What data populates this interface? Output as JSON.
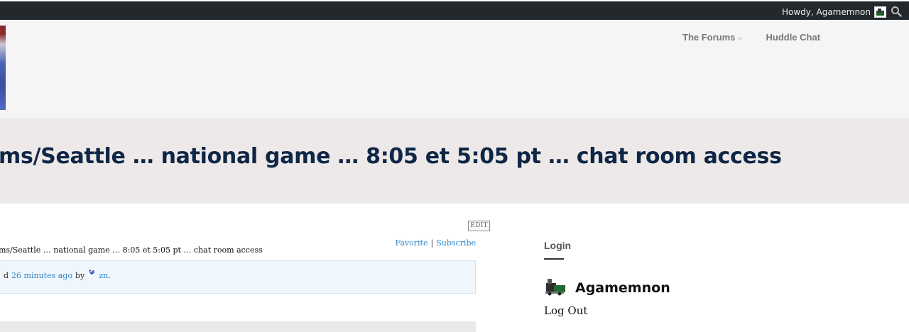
{
  "adminbar": {
    "greeting": "Howdy, Agamemnon",
    "search_icon": "search-icon",
    "avatar_icon": "user-avatar-icon"
  },
  "nav": {
    "items": [
      {
        "label": "The Forums",
        "has_dropdown": true
      },
      {
        "label": "Huddle Chat",
        "has_dropdown": false
      }
    ]
  },
  "page": {
    "title": "ms/Seattle … national game … 8:05 et 5:05 pt … chat room access"
  },
  "topic": {
    "edit_label": "EDIT",
    "favorite_label": "Favorite",
    "separator": "|",
    "subscribe_label": "Subscribe",
    "breadcrumb_title": "ms/Seattle … national game … 8:05 et 5:05 pt … chat room access",
    "notice_prefix": "d",
    "notice_time": "26 minutes ago",
    "notice_by": "by",
    "notice_author": "zn",
    "notice_suffix": "."
  },
  "sidebar": {
    "login_heading": "Login",
    "username": "Agamemnon",
    "logout_label": "Log Out"
  },
  "colors": {
    "adminbar_bg": "#23282d",
    "header_bg": "#f5f5f5",
    "title_band_bg": "#ede9e8",
    "title_color": "#0f2746",
    "link_color": "#2e86c9",
    "notice_bg": "#f0f7fc"
  }
}
